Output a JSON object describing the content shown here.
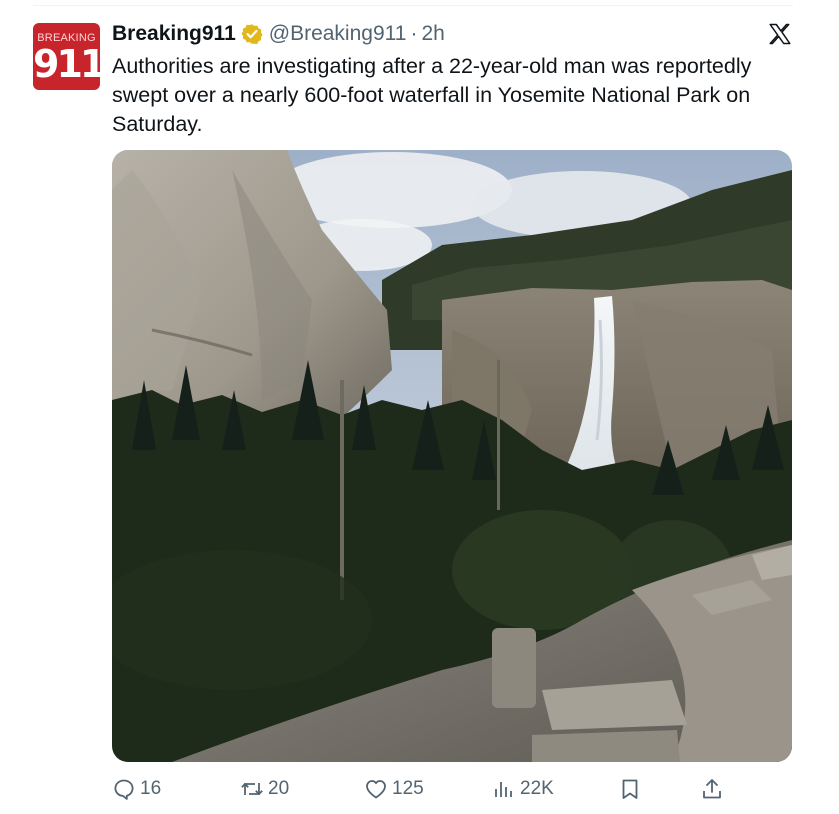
{
  "tweet": {
    "author": {
      "name": "Breaking911",
      "handle": "@Breaking911",
      "time": "2h",
      "separator": "·",
      "avatar_label_top": "BREAKING",
      "avatar_label_main": "911",
      "verified_color": "#e2b719"
    },
    "text": "Authorities are investigating after a 22-year-old man was reportedly\nswept over a nearly 600-foot waterfall in Yosemite National Park on\nSaturday.",
    "media": {
      "description_icon": "photo-waterfall"
    },
    "actions": {
      "replies": "16",
      "reposts": "20",
      "likes": "125",
      "views": "22K"
    }
  },
  "icons": {
    "close": "x-logo-icon",
    "reply": "reply-icon",
    "repost": "repost-icon",
    "like": "heart-icon",
    "views": "views-icon",
    "bookmark": "bookmark-icon",
    "share": "share-icon"
  },
  "colors": {
    "text": "#0f1419",
    "secondary": "#536471",
    "avatar_bg": "#c8242b"
  }
}
